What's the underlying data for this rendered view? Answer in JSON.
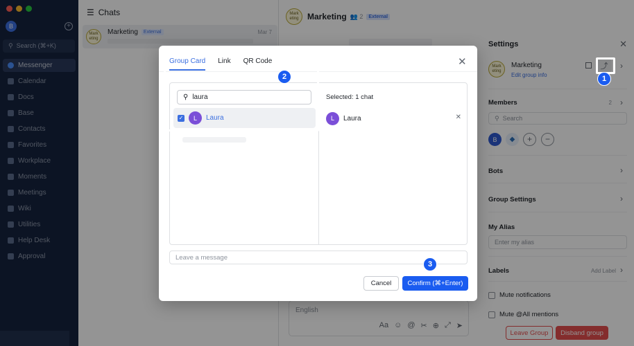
{
  "app": {
    "me_initial": "B",
    "search_label": "Search (⌘+K)",
    "nav": [
      "Messenger",
      "Calendar",
      "Docs",
      "Base",
      "Contacts",
      "Favorites",
      "Workplace",
      "Moments",
      "Meetings",
      "Wiki",
      "Utilities",
      "Help Desk",
      "Approval"
    ]
  },
  "chatlist": {
    "title": "Chats",
    "item": {
      "avatar_text": "Mark eting",
      "name": "Marketing",
      "tag": "External",
      "date": "Mar 7"
    }
  },
  "main": {
    "avatar_text": "Mark eting",
    "title": "Marketing",
    "member_count": "2",
    "tag": "External",
    "composer_placeholder": "English"
  },
  "settings": {
    "title": "Settings",
    "group_name": "Marketing",
    "edit_link": "Edit group info",
    "members_label": "Members",
    "members_count": "2",
    "search_placeholder": "Search",
    "member_initial": "B",
    "bots_label": "Bots",
    "group_settings_label": "Group Settings",
    "alias_label": "My Alias",
    "alias_placeholder": "Enter my alias",
    "labels_label": "Labels",
    "add_label": "Add Label",
    "mute_notifications": "Mute notifications",
    "mute_all": "Mute @All mentions",
    "leave": "Leave Group",
    "disband": "Disband group"
  },
  "dialog": {
    "tabs": [
      "Group Card",
      "Link",
      "QR Code"
    ],
    "active_tab": "Group Card",
    "search_value": "laura",
    "result": {
      "initial": "L",
      "name": "Laura",
      "checked": true
    },
    "selected_label": "Selected: 1 chat",
    "selected": {
      "initial": "L",
      "name": "Laura"
    },
    "message_placeholder": "Leave a message",
    "cancel": "Cancel",
    "confirm": "Confirm (⌘+Enter)"
  },
  "steps": [
    "1",
    "2",
    "3"
  ],
  "colors": {
    "accent": "#1a5cf0",
    "danger": "#e34e4e",
    "sidebar": "#16243f"
  }
}
